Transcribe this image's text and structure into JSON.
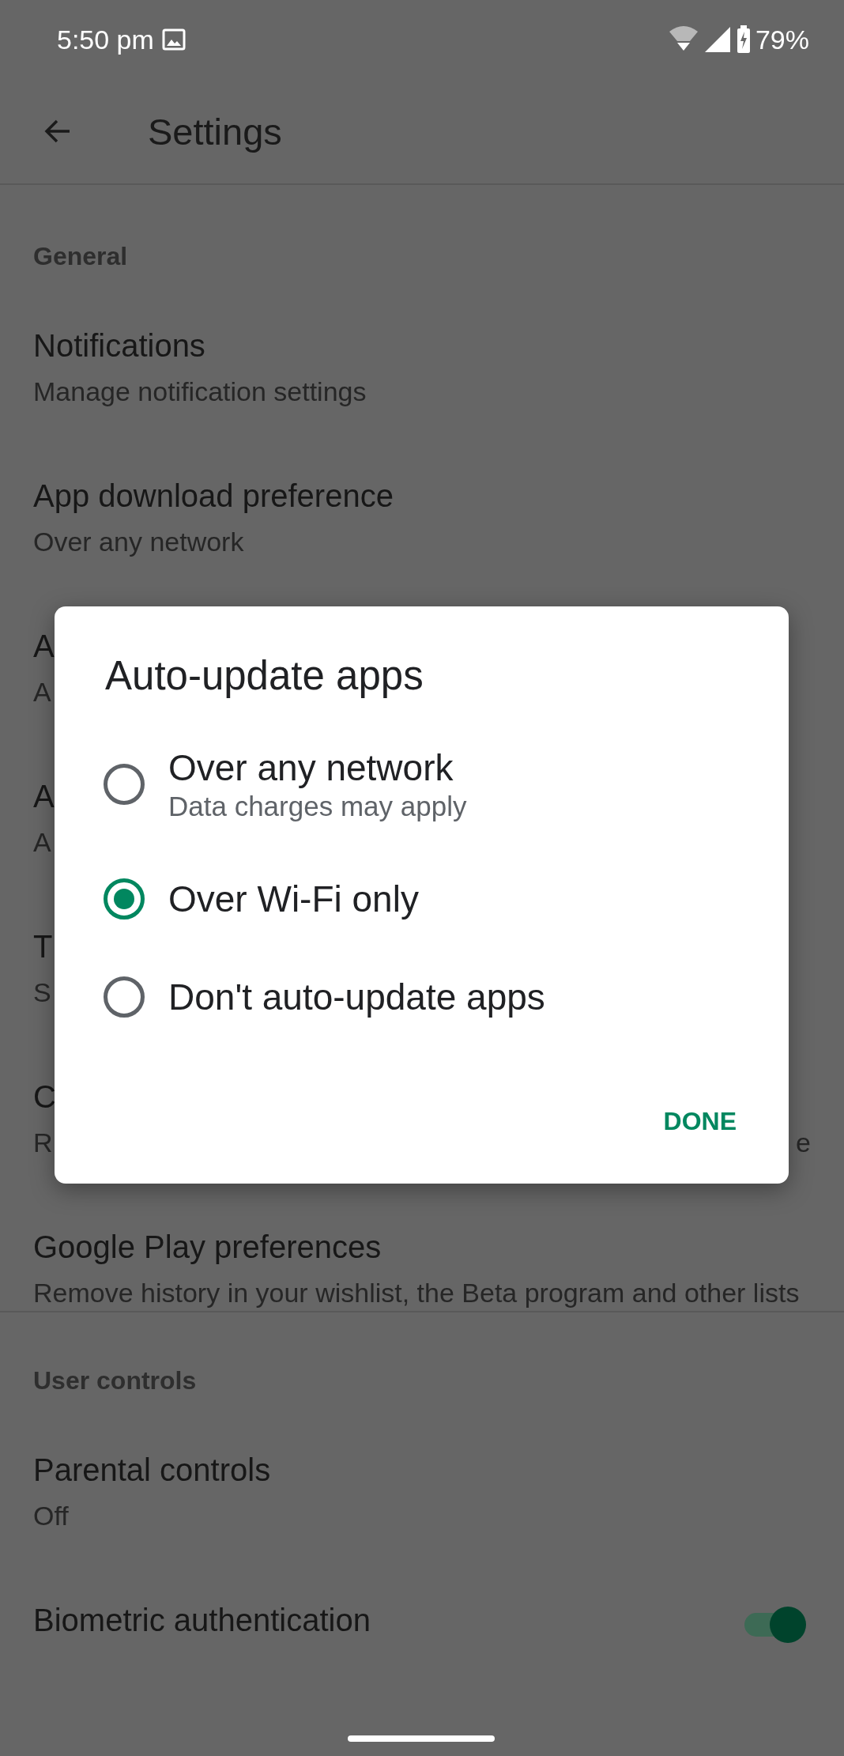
{
  "status_bar": {
    "time": "5:50 pm",
    "battery": "79%"
  },
  "app_bar": {
    "title": "Settings"
  },
  "sections": [
    {
      "header": "General",
      "items": [
        {
          "kind": "text",
          "title": "Notifications",
          "subtitle": "Manage notification settings"
        },
        {
          "kind": "text",
          "title": "App download preference",
          "subtitle": "Over any network"
        },
        {
          "kind": "text",
          "title": "A",
          "subtitle": "A"
        },
        {
          "kind": "text",
          "title": "A",
          "subtitle": "A"
        },
        {
          "kind": "text",
          "title": "T",
          "subtitle": "S"
        },
        {
          "kind": "text",
          "title": "C",
          "subtitle": "R",
          "trailing": "e"
        },
        {
          "kind": "text",
          "title": "Google Play preferences",
          "subtitle": "Remove history in your wishlist, the Beta program and other lists"
        }
      ]
    },
    {
      "header": "User controls",
      "items": [
        {
          "kind": "text",
          "title": "Parental controls",
          "subtitle": "Off"
        },
        {
          "kind": "toggle",
          "title": "Biometric authentication",
          "on": true
        }
      ]
    }
  ],
  "dialog": {
    "title": "Auto-update apps",
    "options": [
      {
        "label": "Over any network",
        "description": "Data charges may apply",
        "selected": false
      },
      {
        "label": "Over Wi-Fi only",
        "selected": true
      },
      {
        "label": "Don't auto-update apps",
        "selected": false
      }
    ],
    "button": "DONE"
  }
}
